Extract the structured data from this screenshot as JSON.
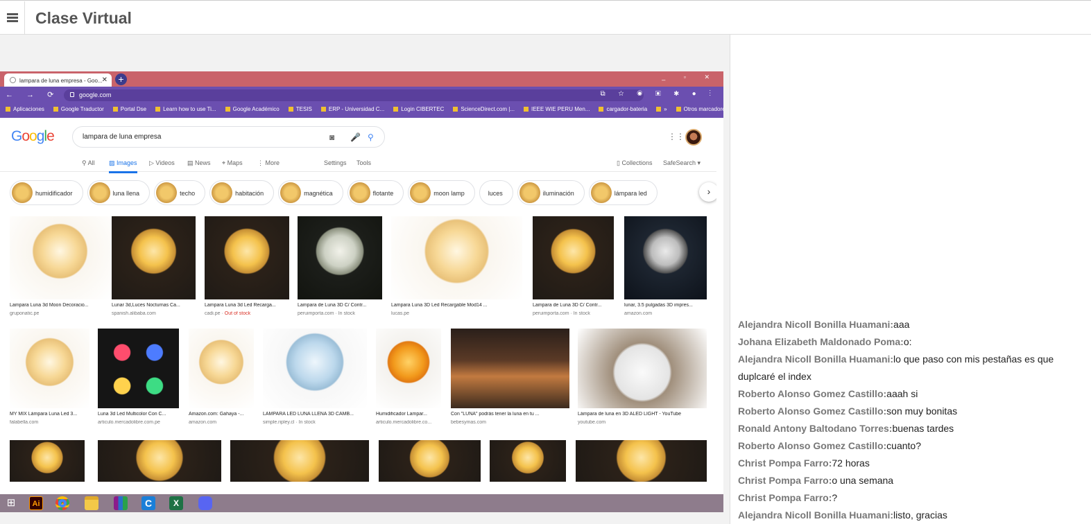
{
  "app": {
    "title": "Clase Virtual"
  },
  "browser": {
    "tab_title": "lampara de luna empresa - Goo...",
    "tab_close": "✕",
    "new_tab": "+",
    "window_controls": "_ ▫ ✕",
    "nav": "← → ⟳ ⌂",
    "url": "google.com",
    "extensions": "⧉ ☆ ◉ ▣ ✱ ● ⋮",
    "bookmarks": [
      "Aplicaciones",
      "Google Traductor",
      "Portal Dse",
      "Learn how to use Ti...",
      "Google Académico",
      "TESIS",
      "ERP - Universidad C...",
      "Login CIBERTEC",
      "ScienceDirect.com |...",
      "IEEE WIE PERU Men...",
      "cargador-bateria",
      "»",
      "Otros marcadores"
    ]
  },
  "google": {
    "logo": [
      "G",
      "o",
      "o",
      "g",
      "l",
      "e"
    ],
    "logo_colors": [
      "#4285f4",
      "#ea4335",
      "#fbbc05",
      "#4285f4",
      "#34a853",
      "#ea4335"
    ],
    "query": "lampara de luna empresa",
    "tabs": {
      "all": "All",
      "images": "Images",
      "videos": "Videos",
      "news": "News",
      "maps": "Maps",
      "more": "More",
      "settings": "Settings",
      "tools": "Tools",
      "collections": "Collections",
      "safesearch": "SafeSearch ▾"
    },
    "chips": [
      "humidificador",
      "luna llena",
      "techo",
      "habitación",
      "magnética",
      "flotante",
      "moon lamp",
      "luces",
      "iluminación",
      "lámpara led"
    ],
    "results_row1": [
      {
        "caption": "Lampara Luna 3d Moon Decoracio...",
        "source": "gruponatic.pe",
        "status": ""
      },
      {
        "caption": "Lunar 3d,Luces Nocturnas Ca...",
        "source": "spanish.alibaba.com",
        "status": ""
      },
      {
        "caption": "Lampara Luna 3d Led Recarga...",
        "source": "cadi.pe · ",
        "status": "Out of stock"
      },
      {
        "caption": "Lampara de Luna 3D C/ Contr...",
        "source": "peruimporta.com · In stock",
        "status": ""
      },
      {
        "caption": "Lampara Luna 3D Led Recargable Mod14 ...",
        "source": "lucas.pe",
        "status": ""
      },
      {
        "caption": "Lampara de Luna 3D C/ Contr...",
        "source": "peruimporta.com · In stock",
        "status": ""
      },
      {
        "caption": "lunar, 3.5 pulgadas 3D impres...",
        "source": "amazon.com",
        "status": ""
      }
    ],
    "results_row2": [
      {
        "caption": "MY MIX Lámpara Luna Led 3...",
        "source": "falabella.com"
      },
      {
        "caption": "Luna 3d Led Multicolor Con C...",
        "source": "articulo.mercadolibre.com.pe"
      },
      {
        "caption": "Amazon.com: Gahaya -...",
        "source": "amazon.com"
      },
      {
        "caption": "LAMPARA LED LUNA LLENA 3D CAMB...",
        "source": "simple.ripley.cl · In stock"
      },
      {
        "caption": "Humidificador Lampar...",
        "source": "articulo.mercadolibre.co..."
      },
      {
        "caption": "Con \"LUNA\" podrás tener la luna en tu ...",
        "source": "bebesymas.com"
      },
      {
        "caption": "Lámpara de luna en 3D ALED LIGHT - YouTube",
        "source": "youtube.com"
      }
    ]
  },
  "chat": {
    "messages": [
      {
        "author": "Alejandra Nicoll Bonilla Huamani:",
        "text": "aaa"
      },
      {
        "author": "Johana Elizabeth Maldonado Poma:",
        "text": "o:"
      },
      {
        "author": "Alejandra Nicoll Bonilla Huamani:",
        "text": "lo que paso con mis pestañas es que duplcaré el index"
      },
      {
        "author": "Roberto Alonso Gomez Castillo:",
        "text": "aaah si"
      },
      {
        "author": "Roberto Alonso Gomez Castillo:",
        "text": "son muy bonitas"
      },
      {
        "author": "Ronald Antony Baltodano Torres:",
        "text": "buenas tardes"
      },
      {
        "author": "Roberto Alonso Gomez Castillo:",
        "text": "cuanto?"
      },
      {
        "author": "Christ Pompa Farro:",
        "text": "72 horas"
      },
      {
        "author": "Christ Pompa Farro:",
        "text": "o una semana"
      },
      {
        "author": "Christ Pompa Farro:",
        "text": "?"
      },
      {
        "author": "Alejandra Nicoll Bonilla Huamani:",
        "text": "listo, gracias"
      }
    ]
  },
  "taskbar": {
    "apps": [
      "windows-start",
      "illustrator",
      "chrome",
      "file-explorer",
      "winrar",
      "ccleaner",
      "excel",
      "discord"
    ],
    "ai_label": "Ai",
    "excel_label": "X",
    "ccleaner_label": "C"
  }
}
